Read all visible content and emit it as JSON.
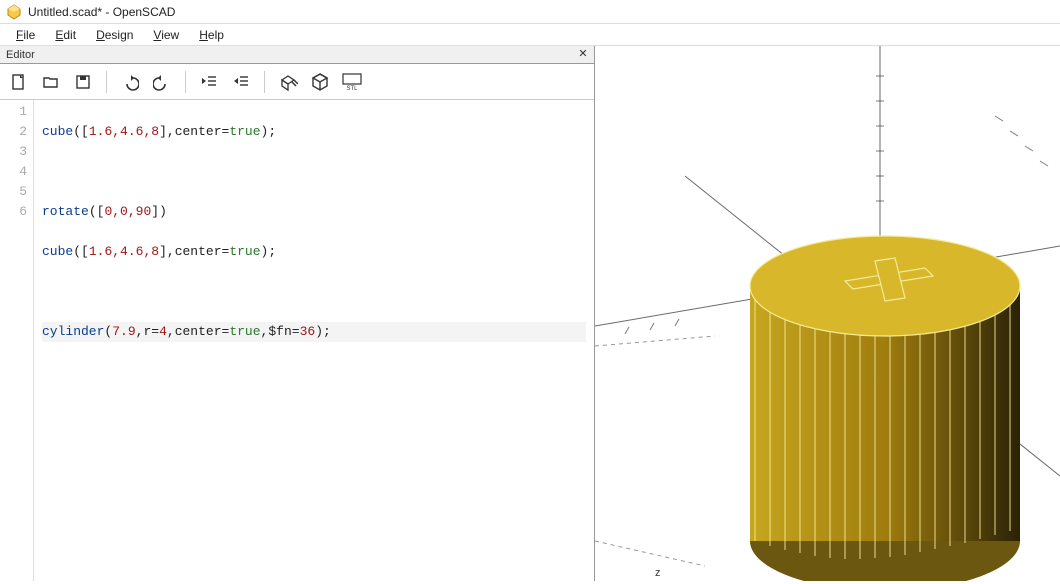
{
  "window": {
    "title": "Untitled.scad* - OpenSCAD"
  },
  "menu": {
    "file": "File",
    "edit": "Edit",
    "design": "Design",
    "view": "View",
    "help": "Help"
  },
  "editor": {
    "panel_title": "Editor",
    "close": "✕",
    "line_numbers": [
      "1",
      "2",
      "3",
      "4",
      "5",
      "6"
    ],
    "tokens": {
      "cube": "cube",
      "rotate": "rotate",
      "cylinder": "cylinder",
      "center": "center",
      "true": "true",
      "fn": "$fn",
      "r": "r",
      "l1_nums": "1.6,4.6,8",
      "l3_nums": "0,0,90",
      "l4_nums": "1.6,4.6,8",
      "l6_79": "7.9",
      "l6_r4": "4",
      "l6_fn36": "36",
      "semi": ";",
      "eq": "=",
      "comma": ",",
      "lp": "(",
      "rp": ")",
      "lb": "[",
      "rb": "]"
    }
  },
  "toolbar": {
    "new": "new",
    "open": "open",
    "save": "save",
    "undo": "undo",
    "redo": "redo",
    "unindent": "unindent",
    "indent": "indent",
    "preview": "preview",
    "render": "render",
    "stl": "stl"
  },
  "viewport": {
    "axis_label": "z"
  }
}
